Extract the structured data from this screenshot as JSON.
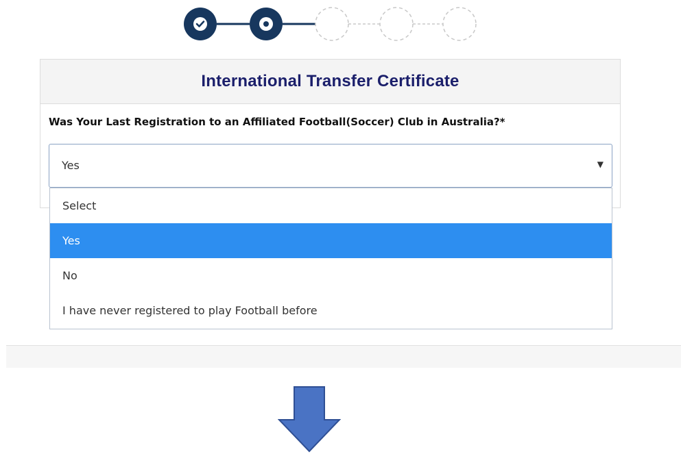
{
  "stepper": {
    "steps": [
      {
        "state": "completed",
        "icon": "check-icon"
      },
      {
        "state": "current",
        "icon": "ring-icon"
      },
      {
        "state": "pending"
      },
      {
        "state": "pending"
      },
      {
        "state": "pending"
      }
    ],
    "colors": {
      "active": "#17375e",
      "pending": "#c8c8c8"
    }
  },
  "card": {
    "title": "International Transfer Certificate",
    "question": "Was Your Last Registration to an Affiliated Football(Soccer) Club in Australia?*"
  },
  "select": {
    "value": "Yes",
    "caret": "▼",
    "options": [
      {
        "label": "Select",
        "selected": false
      },
      {
        "label": "Yes",
        "selected": true
      },
      {
        "label": "No",
        "selected": false
      },
      {
        "label": "I have never registered to play Football before",
        "selected": false
      }
    ]
  },
  "colors": {
    "title": "#1b1f6b",
    "highlight": "#2d8ef0",
    "arrow": "#4a73c4"
  },
  "annotation": {
    "icon": "down-arrow-icon"
  }
}
